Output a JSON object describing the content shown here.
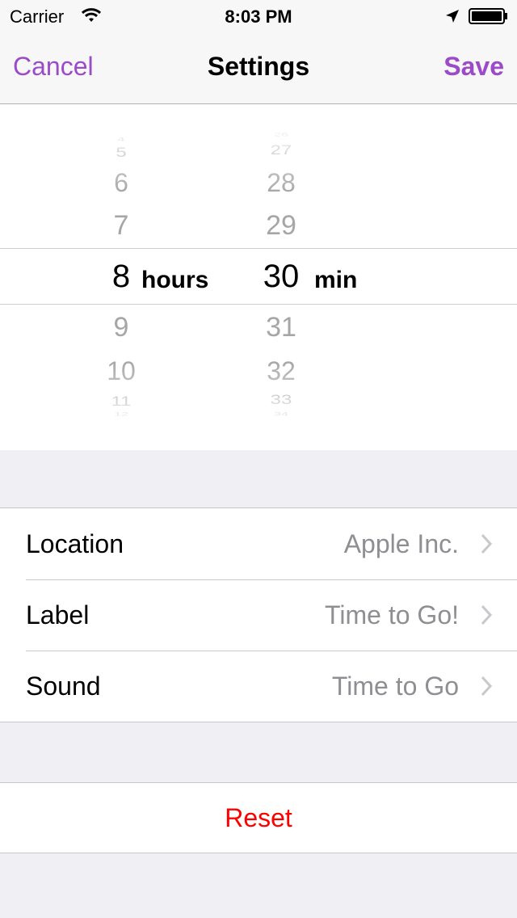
{
  "status_bar": {
    "carrier": "Carrier",
    "time": "8:03 PM"
  },
  "nav": {
    "cancel_label": "Cancel",
    "title": "Settings",
    "save_label": "Save",
    "accent_color": "#9b4bc8"
  },
  "picker": {
    "hours": [
      "4",
      "5",
      "6",
      "7",
      "8",
      "9",
      "10",
      "11",
      "12"
    ],
    "minutes": [
      "26",
      "27",
      "28",
      "29",
      "30",
      "31",
      "32",
      "33",
      "34"
    ],
    "selected_hour": "8",
    "selected_minute": "30",
    "hours_unit": "hours",
    "minutes_unit": "min"
  },
  "settings": {
    "rows": [
      {
        "label": "Location",
        "value": "Apple Inc."
      },
      {
        "label": "Label",
        "value": "Time to Go!"
      },
      {
        "label": "Sound",
        "value": "Time to Go"
      }
    ]
  },
  "reset": {
    "label": "Reset",
    "color": "#ff0000"
  },
  "icons": [
    "wifi-icon",
    "location-arrow-icon",
    "battery-icon",
    "chevron-right-icon"
  ]
}
